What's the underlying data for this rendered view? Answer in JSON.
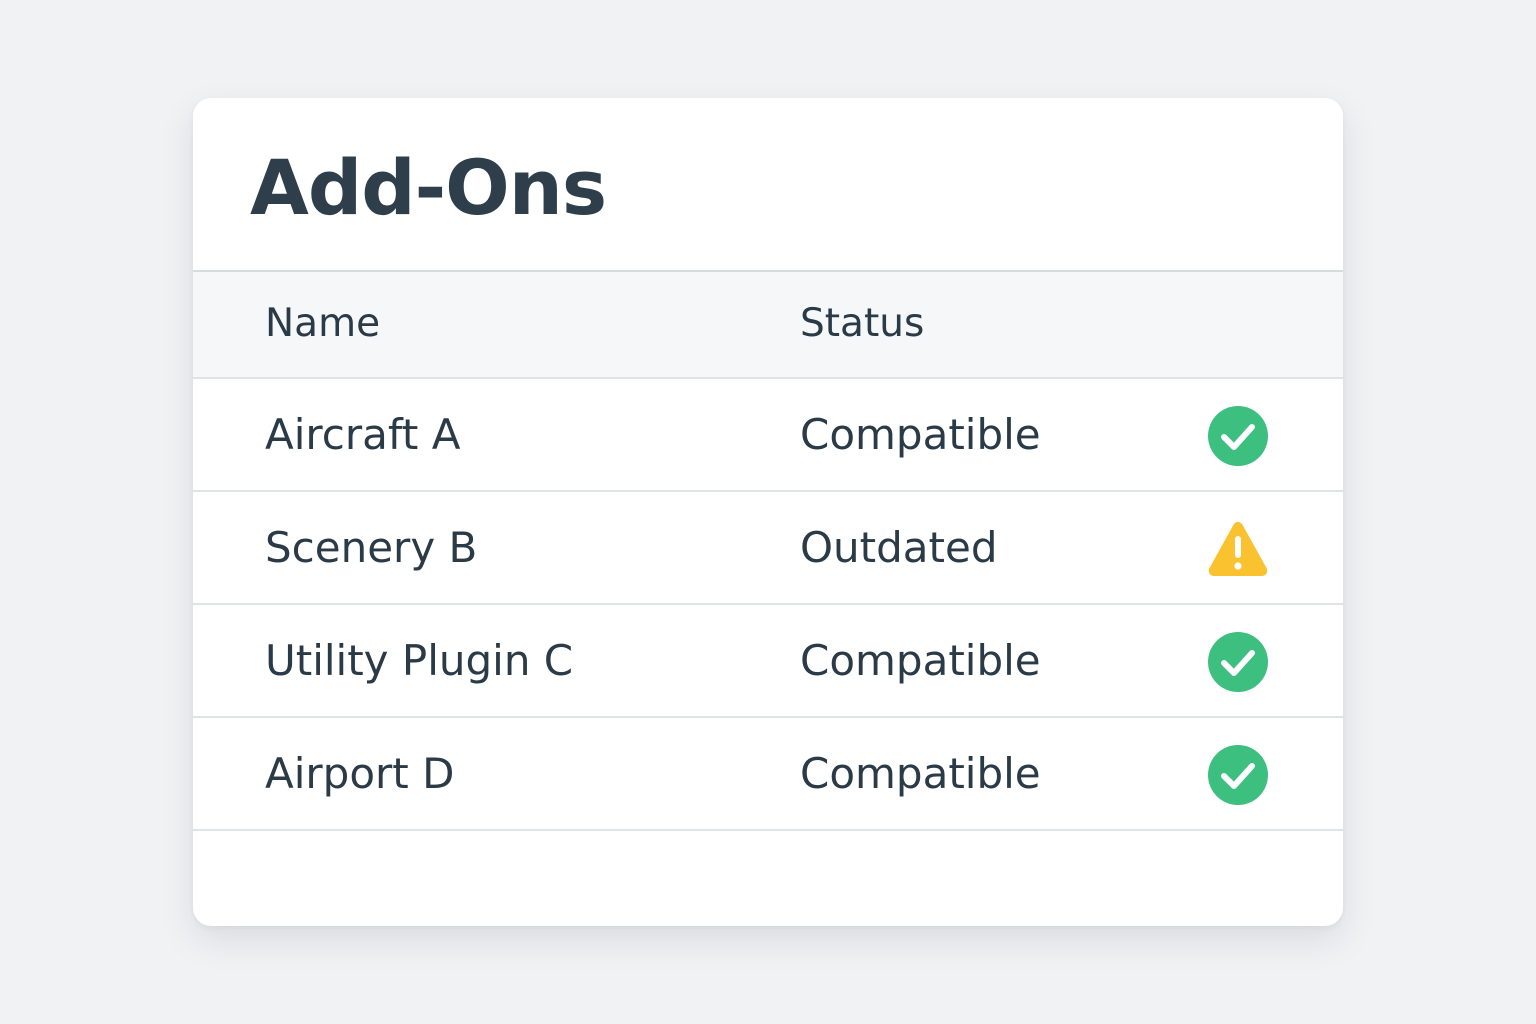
{
  "title": "Add-Ons",
  "table": {
    "headers": {
      "name": "Name",
      "status": "Status"
    },
    "rows": [
      {
        "name": "Aircraft A",
        "status": "Compatible",
        "icon": "check-circle-icon"
      },
      {
        "name": "Scenery B",
        "status": "Outdated",
        "icon": "warning-triangle-icon"
      },
      {
        "name": "Utility Plugin C",
        "status": "Compatible",
        "icon": "check-circle-icon"
      },
      {
        "name": "Airport D",
        "status": "Compatible",
        "icon": "check-circle-icon"
      }
    ]
  },
  "colors": {
    "compatible": "#3cbf7f",
    "outdated": "#f9c22e",
    "text": "#2b3a47",
    "background": "#f1f2f4"
  }
}
